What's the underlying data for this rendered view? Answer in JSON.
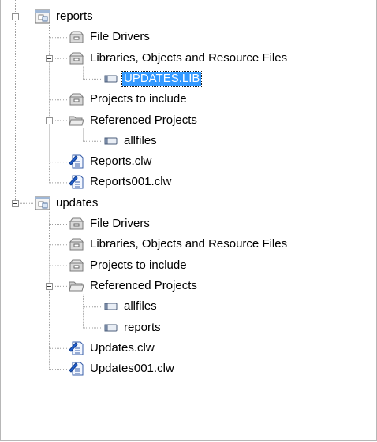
{
  "tree": {
    "nodes": [
      {
        "label": "reports",
        "icon": "project-icon",
        "depth": 0,
        "expanded": true
      },
      {
        "label": "File Drivers",
        "icon": "drawer-icon",
        "depth": 1
      },
      {
        "label": "Libraries, Objects and Resource Files",
        "icon": "drawer-icon",
        "depth": 1,
        "expanded": true
      },
      {
        "label": "UPDATES.LIB",
        "icon": "file-item-icon",
        "depth": 2,
        "selected": true
      },
      {
        "label": "Projects to include",
        "icon": "drawer-icon",
        "depth": 1
      },
      {
        "label": "Referenced Projects",
        "icon": "folder-open-icon",
        "depth": 1,
        "expanded": true
      },
      {
        "label": "allfiles",
        "icon": "file-item-icon",
        "depth": 2
      },
      {
        "label": "Reports.clw",
        "icon": "clw-file-icon",
        "depth": 1
      },
      {
        "label": "Reports001.clw",
        "icon": "clw-file-icon",
        "depth": 1
      },
      {
        "label": "updates",
        "icon": "project-icon",
        "depth": 0,
        "expanded": true
      },
      {
        "label": "File Drivers",
        "icon": "drawer-icon",
        "depth": 1
      },
      {
        "label": "Libraries, Objects and Resource Files",
        "icon": "drawer-icon",
        "depth": 1
      },
      {
        "label": "Projects to include",
        "icon": "drawer-icon",
        "depth": 1
      },
      {
        "label": "Referenced Projects",
        "icon": "folder-open-icon",
        "depth": 1,
        "expanded": true
      },
      {
        "label": "allfiles",
        "icon": "file-item-icon",
        "depth": 2
      },
      {
        "label": "reports",
        "icon": "file-item-icon",
        "depth": 2
      },
      {
        "label": "Updates.clw",
        "icon": "clw-file-icon",
        "depth": 1
      },
      {
        "label": "Updates001.clw",
        "icon": "clw-file-icon",
        "depth": 1
      }
    ]
  },
  "colors": {
    "selection": "#3399ff",
    "tree_line": "#a0a0a0",
    "border": "#b7b7b7"
  }
}
